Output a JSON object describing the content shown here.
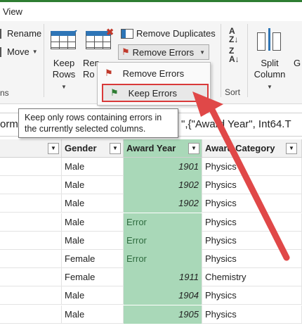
{
  "window": {
    "view_tab": "View"
  },
  "ribbon": {
    "rename": "Rename",
    "move": "Move",
    "partial_group": "ns",
    "keep_rows_line1": "Keep",
    "keep_rows_line2": "Rows",
    "remove_rows_line1": "Ren",
    "remove_rows_line2": "Ro",
    "remove_duplicates": "Remove Duplicates",
    "remove_errors": "Remove Errors",
    "sort_group": "Sort",
    "split_line1": "Split",
    "split_line2": "Column",
    "partial_right": "G"
  },
  "dropdown": {
    "items": [
      {
        "label": "Remove Errors"
      },
      {
        "label": "Keep Errors"
      }
    ]
  },
  "tooltip": {
    "line1": "Keep only rows containing errors in",
    "line2": "the currently selected columns."
  },
  "formula_bar": {
    "left": "orm",
    "right": "\",{\"Award Year\", Int64.T"
  },
  "table": {
    "columns": [
      {
        "label": ""
      },
      {
        "label": "Gender"
      },
      {
        "label": "Award Year"
      },
      {
        "label": "Award Category"
      }
    ],
    "rows": [
      {
        "gender": "Male",
        "year": "1901",
        "category": "Physics"
      },
      {
        "gender": "Male",
        "year": "1902",
        "category": "Physics"
      },
      {
        "gender": "Male",
        "year": "1902",
        "category": "Physics"
      },
      {
        "gender": "Male",
        "year": "Error",
        "category": "Physics"
      },
      {
        "gender": "Male",
        "year": "Error",
        "category": "Physics"
      },
      {
        "gender": "Female",
        "year": "Error",
        "category": "Physics"
      },
      {
        "gender": "Female",
        "year": "1911",
        "category": "Chemistry"
      },
      {
        "gender": "Male",
        "year": "1904",
        "category": "Physics"
      },
      {
        "gender": "Male",
        "year": "1905",
        "category": "Physics"
      }
    ]
  },
  "colors": {
    "accent_green": "#2e7d32",
    "selected_column": "#a9d8b8",
    "highlight_red": "#d93a3a",
    "arrow_red": "#e04848"
  }
}
